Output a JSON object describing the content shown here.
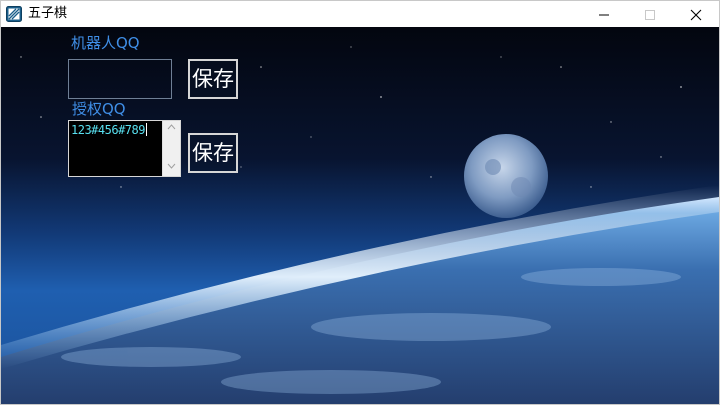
{
  "window": {
    "title": "五子棋",
    "icon": "app-icon",
    "controls": [
      "minimize-icon",
      "maximize-icon",
      "close-icon"
    ]
  },
  "form": {
    "robot_qq_label": "机器人QQ",
    "robot_qq_value": "",
    "save_label_1": "保存",
    "auth_qq_label": "授权QQ",
    "auth_qq_value": "123#456#789",
    "save_label_2": "保存"
  },
  "colors": {
    "label": "#3f8ee6",
    "textarea_text": "#58e0f0",
    "textarea_bg": "#000000"
  }
}
